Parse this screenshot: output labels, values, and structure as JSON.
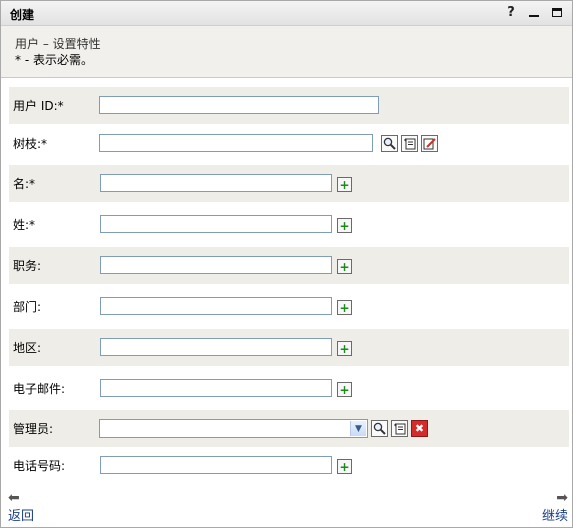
{
  "window": {
    "title": "创建",
    "help_icon": "?",
    "minimize_icon": "minimize-icon",
    "maximize_icon": "maximize-icon"
  },
  "header": {
    "subtitle": "用户 – 设置特性",
    "required_note": "* - 表示必需。"
  },
  "form": {
    "fields": [
      {
        "label": "用户 ID:*",
        "value": ""
      },
      {
        "label": "树枝:*",
        "value": ""
      },
      {
        "label": "名:*",
        "value": ""
      },
      {
        "label": "姓:*",
        "value": ""
      },
      {
        "label": "职务:",
        "value": ""
      },
      {
        "label": "部门:",
        "value": ""
      },
      {
        "label": "地区:",
        "value": ""
      },
      {
        "label": "电子邮件:",
        "value": ""
      },
      {
        "label": "管理员:",
        "value": ""
      },
      {
        "label": "电话号码:",
        "value": ""
      }
    ],
    "add_symbol": "+",
    "delete_symbol": "✖"
  },
  "footer": {
    "back_label": "返回",
    "continue_label": "继续",
    "back_arrow": "⬅",
    "continue_arrow": "➡"
  },
  "colors": {
    "alt_row": "#eeede8",
    "link": "#1a3f86",
    "add_green": "#1b8a1b",
    "delete_red": "#d42b2b"
  }
}
